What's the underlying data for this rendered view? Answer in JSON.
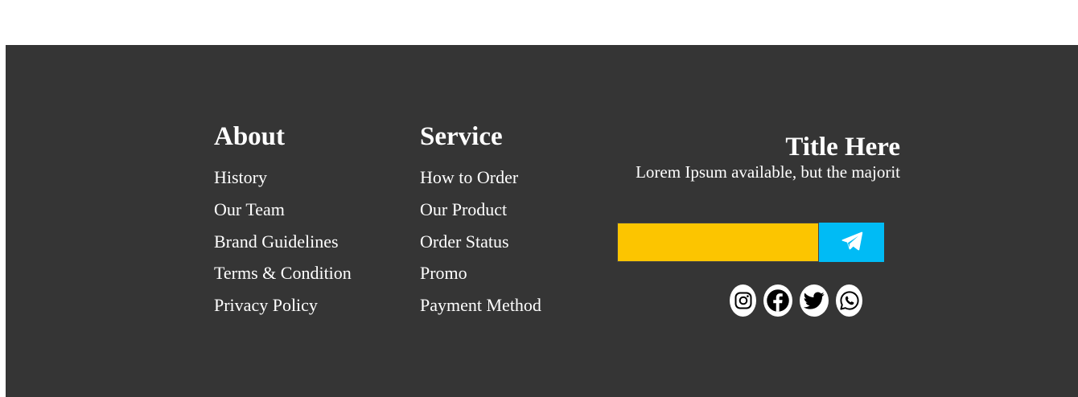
{
  "footer": {
    "about": {
      "title": "About",
      "links": [
        "History",
        "Our Team",
        "Brand Guidelines",
        "Terms & Condition",
        "Privacy Policy"
      ]
    },
    "service": {
      "title": "Service",
      "links": [
        "How to Order",
        "Our Product",
        "Order Status",
        "Promo",
        "Payment Method"
      ]
    },
    "newsletter": {
      "title": "Title Here",
      "text": "Lorem Ipsum available, but the majorit",
      "input_value": "",
      "input_placeholder": "",
      "submit_icon": "telegram-send-icon"
    },
    "socials": [
      "instagram-icon",
      "facebook-icon",
      "twitter-icon",
      "whatsapp-icon"
    ]
  },
  "colors": {
    "footer_bg": "#353535",
    "input_bg": "#fcc500",
    "button_bg": "#00bbf5",
    "text": "#ffffff"
  }
}
